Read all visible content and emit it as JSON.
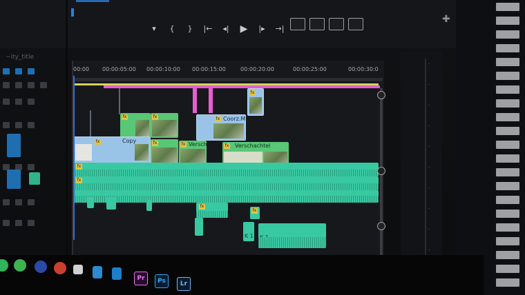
{
  "transport": {
    "buttons": [
      "▾",
      "{",
      "}",
      "|←",
      "◂|",
      "▶",
      "|▸",
      "→|"
    ]
  },
  "left_panel": {
    "dim_label": "~ity_title"
  },
  "ruler": {
    "timecodes": [
      "00:00",
      "00:00:05:00",
      "00:00:10:00",
      "00:00:15:00",
      "00:00:20:00",
      "00:00:25:00",
      "00:00:30:0"
    ]
  },
  "clips": {
    "copy_a": "Copy",
    "coorz": "Coorz.MP",
    "versch_1": "Versch",
    "versch_2": "Verschachtel",
    "fx": "fx"
  },
  "audio": {
    "k1_a": "K 1",
    "k1_b": "K 1"
  },
  "taskbar": {
    "apps": [
      "Pr",
      "Ps",
      "Lr"
    ]
  },
  "meter": {
    "ticks": [
      "-",
      "-",
      "-",
      "-",
      "-",
      "-",
      "-",
      "-",
      "-",
      "-"
    ]
  },
  "colors": {
    "accent_blue": "#2d7fd6",
    "video_clip": "#9ac3e8",
    "nested_clip": "#58c776",
    "audio_clip": "#39c9a2",
    "work_area": "#d6d25c",
    "marker": "#e25fd0"
  }
}
